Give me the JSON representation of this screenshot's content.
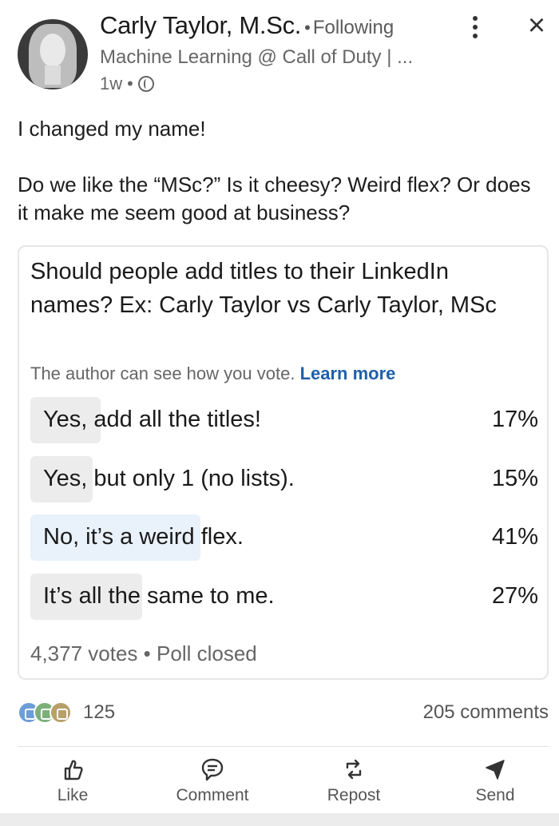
{
  "post": {
    "author": {
      "name": "Carly Taylor, M.Sc.",
      "separator": "•",
      "following": "Following",
      "headline": "Machine Learning @ Call of Duty | ...",
      "time": "1w",
      "time_sep": "•",
      "visibility_icon": "globe-icon"
    },
    "text_paragraphs": [
      "I changed my name!",
      "Do we like the “MSc?” Is it cheesy? Weird flex? Or does it make me seem good at business?"
    ]
  },
  "poll": {
    "question": "Should people add titles to their LinkedIn names? Ex: Carly Taylor vs Carly Taylor, MSc",
    "note": "The author can see how you vote.",
    "learn_more": "Learn more",
    "options": [
      {
        "label": "Yes, add all the titles!",
        "percent": "17%",
        "share": 17
      },
      {
        "label": "Yes, but only 1 (no lists).",
        "percent": "15%",
        "share": 15
      },
      {
        "label": "No, it’s a weird flex.",
        "percent": "41%",
        "share": 41,
        "leading": true
      },
      {
        "label": "It’s all the same to me.",
        "percent": "27%",
        "share": 27
      }
    ],
    "votes": "4,377 votes",
    "status_sep": "•",
    "status": "Poll closed"
  },
  "social": {
    "reaction_icons": [
      "like-icon",
      "celebrate-icon",
      "support-icon"
    ],
    "reaction_count": "125",
    "comments": "205 comments"
  },
  "actions": {
    "like": "Like",
    "comment": "Comment",
    "repost": "Repost",
    "send": "Send"
  },
  "colors": {
    "link": "#1f5fa8",
    "bar_default": "#ececec",
    "bar_leading": "#e9f1fb"
  }
}
